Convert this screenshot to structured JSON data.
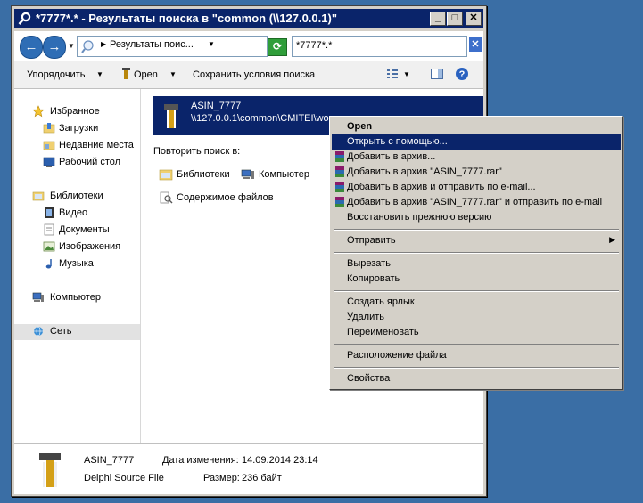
{
  "window": {
    "title": "*7777*.* - Результаты поиска в \"common (\\\\127.0.0.1)\""
  },
  "titlebar_buttons": {
    "minimize": "_",
    "maximize": "□",
    "close": "✕"
  },
  "navigation": {
    "back": "←",
    "forward": "→"
  },
  "breadcrumb": {
    "text": "Результаты поис..."
  },
  "search": {
    "value": "*7777*.*"
  },
  "toolbar": {
    "organize": "Упорядочить",
    "open": "Open",
    "save_search": "Сохранить условия поиска"
  },
  "sidebar": {
    "favorites": {
      "label": "Избранное",
      "items": [
        "Загрузки",
        "Недавние места",
        "Рабочий стол"
      ]
    },
    "libraries": {
      "label": "Библиотеки",
      "items": [
        "Видео",
        "Документы",
        "Изображения",
        "Музыка"
      ]
    },
    "computer": "Компьютер",
    "network": "Сеть"
  },
  "result": {
    "name": "ASIN_7777",
    "path": "\\\\127.0.0.1\\common\\CMITEI\\wor..."
  },
  "repeat_search": {
    "label": "Повторить поиск в:",
    "libraries": "Библиотеки",
    "computer": "Компьютер",
    "file_contents": "Содержимое файлов"
  },
  "details": {
    "name": "ASIN_7777",
    "type": "Delphi Source File",
    "modified_label": "Дата изменения:",
    "modified_value": "14.09.2014 23:14",
    "size_label": "Размер:",
    "size_value": "236 байт"
  },
  "context_menu": {
    "items": [
      "Open",
      "Открыть с помощью...",
      "Добавить в архив...",
      "Добавить в архив \"ASIN_7777.rar\"",
      "Добавить в архив и отправить по e-mail...",
      "Добавить в архив \"ASIN_7777.rar\" и отправить по e-mail",
      "Восстановить прежнюю версию",
      "Отправить",
      "Вырезать",
      "Копировать",
      "Создать ярлык",
      "Удалить",
      "Переименовать",
      "Расположение файла",
      "Свойства"
    ]
  },
  "colors": {
    "desktop": "#3a6ea5",
    "titlebar": "#0a246a",
    "selection": "#0a246a",
    "menu_bg": "#d4d0c8"
  }
}
